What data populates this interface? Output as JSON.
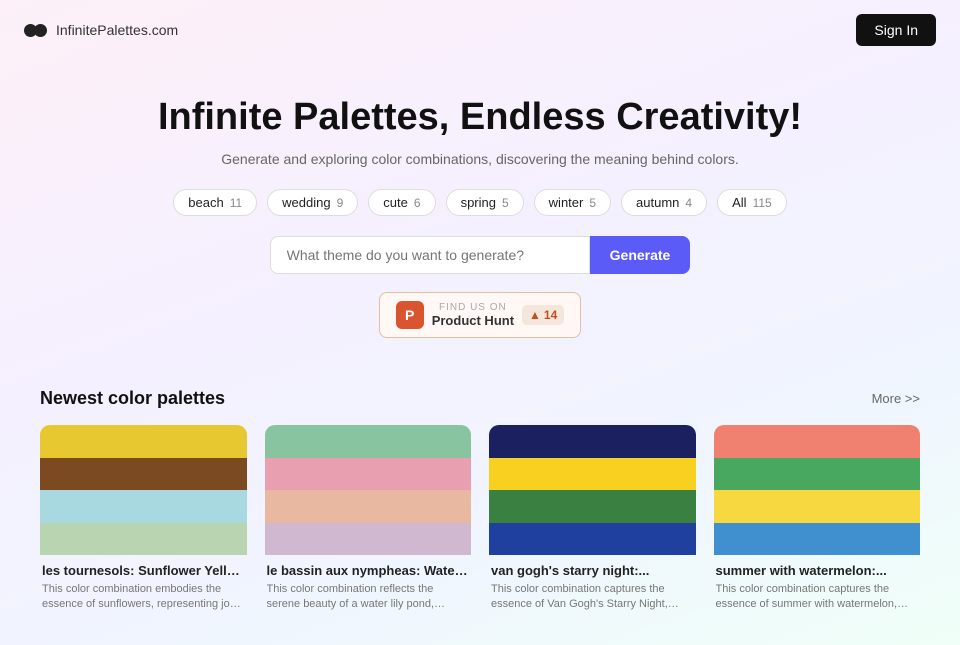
{
  "header": {
    "logo_text": "InfinitePalettes.com",
    "sign_in_label": "Sign In"
  },
  "hero": {
    "title": "Infinite Palettes, Endless Creativity!",
    "subtitle": "Generate and exploring color combinations, discovering the meaning behind colors.",
    "search_placeholder": "What theme do you want to generate?",
    "generate_label": "Generate"
  },
  "tags": [
    {
      "label": "beach",
      "count": "11"
    },
    {
      "label": "wedding",
      "count": "9"
    },
    {
      "label": "cute",
      "count": "6"
    },
    {
      "label": "spring",
      "count": "5"
    },
    {
      "label": "winter",
      "count": "5"
    },
    {
      "label": "autumn",
      "count": "4"
    },
    {
      "label": "All",
      "count": "115"
    }
  ],
  "product_hunt": {
    "icon_text": "P",
    "find_text": "FIND US ON",
    "product_text": "Product Hunt",
    "upvote_icon": "▲",
    "upvote_count": "14"
  },
  "palettes_section": {
    "title": "Newest color palettes",
    "more_label": "More >>",
    "palettes": [
      {
        "name": "les tournesols: Sunflower Yello...",
        "description": "This color combination embodies the essence of sunflowers, representing joy, stability, and a connection to nature. Th...",
        "swatches": [
          "#e8c830",
          "#7b4a20",
          "#a8d8e0",
          "#b8d4b0"
        ]
      },
      {
        "name": "le bassin aux nympheas: Water...",
        "description": "This color combination reflects the serene beauty of a water lily pond, combining the tranquility of nature with...",
        "swatches": [
          "#88c4a0",
          "#e8a0b0",
          "#e8b8a0",
          "#d0b8d0"
        ]
      },
      {
        "name": "van gogh's starry night:...",
        "description": "This color combination captures the essence of Van Gogh's Starry Night, blending the calmness of the night sky...",
        "swatches": [
          "#1a2060",
          "#f8d020",
          "#3a8040",
          "#2040a0"
        ]
      },
      {
        "name": "summer with watermelon:...",
        "description": "This color combination captures the essence of summer with watermelon, blending vibrant and refreshing hues th...",
        "swatches": [
          "#f08070",
          "#48a860",
          "#f8d840",
          "#4090d0"
        ]
      }
    ]
  }
}
